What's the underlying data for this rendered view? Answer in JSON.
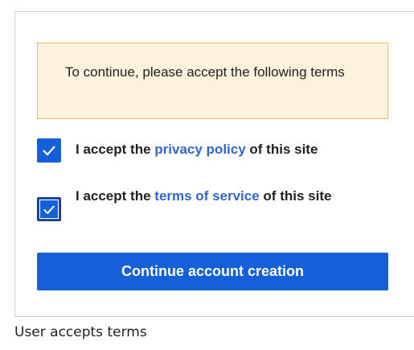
{
  "notice": {
    "text": "To continue, please accept the following terms"
  },
  "privacy": {
    "checked": true,
    "prefix": "I accept the",
    "link": "privacy policy",
    "suffix": "of this site"
  },
  "terms": {
    "checked": true,
    "prefix": "I accept the",
    "link": "terms of service",
    "suffix": "of this site"
  },
  "continue_button": {
    "label": "Continue account creation"
  },
  "caption": "User accepts terms",
  "colors": {
    "accent": "#1560d8",
    "link": "#3366cc",
    "notice_bg": "#fdf3dc",
    "notice_border": "#e8c15a"
  },
  "icons": {
    "checkbox": "check-icon"
  }
}
